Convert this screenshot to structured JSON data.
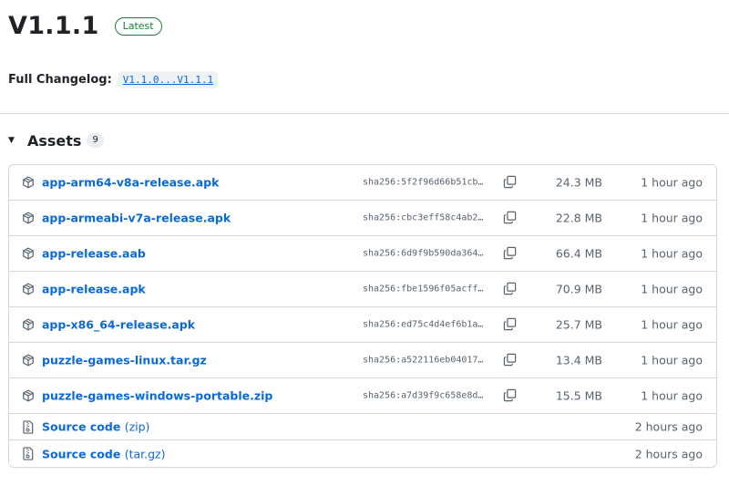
{
  "release": {
    "title": "V1.1.1",
    "badge": "Latest"
  },
  "changelog": {
    "label": "Full Changelog:",
    "link": "V1.1.0...V1.1.1"
  },
  "assets": {
    "title": "Assets",
    "count": "9",
    "files": [
      {
        "name": "app-arm64-v8a-release.apk",
        "sha": "sha256:5f2f96d66b51cb…",
        "size": "24.3 MB",
        "date": "1 hour ago"
      },
      {
        "name": "app-armeabi-v7a-release.apk",
        "sha": "sha256:cbc3eff58c4ab2…",
        "size": "22.8 MB",
        "date": "1 hour ago"
      },
      {
        "name": "app-release.aab",
        "sha": "sha256:6d9f9b590da364…",
        "size": "66.4 MB",
        "date": "1 hour ago"
      },
      {
        "name": "app-release.apk",
        "sha": "sha256:fbe1596f05acff…",
        "size": "70.9 MB",
        "date": "1 hour ago"
      },
      {
        "name": "app-x86_64-release.apk",
        "sha": "sha256:ed75c4d4ef6b1a…",
        "size": "25.7 MB",
        "date": "1 hour ago"
      },
      {
        "name": "puzzle-games-linux.tar.gz",
        "sha": "sha256:a522116eb04017…",
        "size": "13.4 MB",
        "date": "1 hour ago"
      },
      {
        "name": "puzzle-games-windows-portable.zip",
        "sha": "sha256:a7d39f9c658e8d…",
        "size": "15.5 MB",
        "date": "1 hour ago"
      }
    ],
    "source": [
      {
        "name": "Source code",
        "suffix": "(zip)",
        "date": "2 hours ago"
      },
      {
        "name": "Source code",
        "suffix": "(tar.gz)",
        "date": "2 hours ago"
      }
    ]
  },
  "icons": {
    "package": "package-icon",
    "copy": "copy-icon",
    "zip": "file-zip-icon",
    "caret": "triangle-down-icon"
  },
  "colors": {
    "link": "#0969da",
    "badge": "#1a7f37",
    "muted": "#59636e",
    "border": "#d1d9e0"
  }
}
